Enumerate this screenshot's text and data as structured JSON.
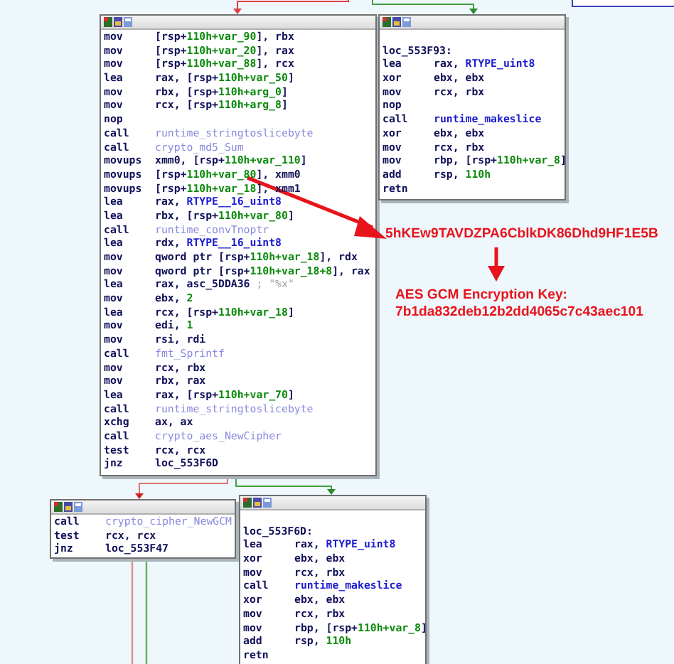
{
  "nodes": [
    {
      "lines": [
        {
          "kind": "instruction",
          "mnemonic": "mov",
          "operand": [
            {
              "text": "[rsp+",
              "kind": "text"
            },
            {
              "text": "110h+var_90",
              "kind": "offset"
            },
            {
              "text": "], rbx",
              "kind": "text"
            }
          ]
        },
        {
          "kind": "instruction",
          "mnemonic": "mov",
          "operand": [
            {
              "text": "[rsp+",
              "kind": "text"
            },
            {
              "text": "110h+var_20",
              "kind": "offset"
            },
            {
              "text": "], rax",
              "kind": "text"
            }
          ]
        },
        {
          "kind": "instruction",
          "mnemonic": "mov",
          "operand": [
            {
              "text": "[rsp+",
              "kind": "text"
            },
            {
              "text": "110h+var_88",
              "kind": "offset"
            },
            {
              "text": "], rcx",
              "kind": "text"
            }
          ]
        },
        {
          "kind": "instruction",
          "mnemonic": "lea",
          "operand": [
            {
              "text": "rax, [rsp+",
              "kind": "text"
            },
            {
              "text": "110h+var_50",
              "kind": "offset"
            },
            {
              "text": "]",
              "kind": "text"
            }
          ]
        },
        {
          "kind": "instruction",
          "mnemonic": "mov",
          "operand": [
            {
              "text": "rbx, [rsp+",
              "kind": "text"
            },
            {
              "text": "110h+arg_0",
              "kind": "offset"
            },
            {
              "text": "]",
              "kind": "text"
            }
          ]
        },
        {
          "kind": "instruction",
          "mnemonic": "mov",
          "operand": [
            {
              "text": "rcx, [rsp+",
              "kind": "text"
            },
            {
              "text": "110h+arg_8",
              "kind": "offset"
            },
            {
              "text": "]",
              "kind": "text"
            }
          ]
        },
        {
          "kind": "instruction",
          "mnemonic": "nop"
        },
        {
          "kind": "instruction",
          "mnemonic": "call",
          "operand": [
            {
              "text": "runtime_stringtoslicebyte",
              "kind": "function"
            }
          ]
        },
        {
          "kind": "instruction",
          "mnemonic": "call",
          "operand": [
            {
              "text": "crypto_md5_Sum",
              "kind": "function"
            }
          ]
        },
        {
          "kind": "instruction",
          "mnemonic": "movups",
          "operand": [
            {
              "text": "xmm0, [rsp+",
              "kind": "text"
            },
            {
              "text": "110h+var_110",
              "kind": "offset"
            },
            {
              "text": "]",
              "kind": "text"
            }
          ]
        },
        {
          "kind": "instruction",
          "mnemonic": "movups",
          "operand": [
            {
              "text": "[rsp+",
              "kind": "text"
            },
            {
              "text": "110h+var_80",
              "kind": "offset"
            },
            {
              "text": "], xmm0",
              "kind": "text"
            }
          ]
        },
        {
          "kind": "instruction",
          "mnemonic": "movups",
          "operand": [
            {
              "text": "[rsp+",
              "kind": "text"
            },
            {
              "text": "110h+var_18",
              "kind": "offset"
            },
            {
              "text": "], xmm1",
              "kind": "text"
            }
          ]
        },
        {
          "kind": "instruction",
          "mnemonic": "lea",
          "operand": [
            {
              "text": "rax, ",
              "kind": "text"
            },
            {
              "text": "RTYPE__16_uint8",
              "kind": "name"
            }
          ]
        },
        {
          "kind": "instruction",
          "mnemonic": "lea",
          "operand": [
            {
              "text": "rbx, [rsp+",
              "kind": "text"
            },
            {
              "text": "110h+var_80",
              "kind": "offset"
            },
            {
              "text": "]",
              "kind": "text"
            }
          ]
        },
        {
          "kind": "instruction",
          "mnemonic": "call",
          "operand": [
            {
              "text": "runtime_convTnoptr",
              "kind": "function"
            }
          ]
        },
        {
          "kind": "instruction",
          "mnemonic": "lea",
          "operand": [
            {
              "text": "rdx, ",
              "kind": "text"
            },
            {
              "text": "RTYPE__16_uint8",
              "kind": "name"
            }
          ]
        },
        {
          "kind": "instruction",
          "mnemonic": "mov",
          "operand": [
            {
              "text": "qword ptr [rsp+",
              "kind": "text"
            },
            {
              "text": "110h+var_18",
              "kind": "offset"
            },
            {
              "text": "], rdx",
              "kind": "text"
            }
          ]
        },
        {
          "kind": "instruction",
          "mnemonic": "mov",
          "operand": [
            {
              "text": "qword ptr [rsp+",
              "kind": "text"
            },
            {
              "text": "110h+var_18+8",
              "kind": "offset"
            },
            {
              "text": "], rax",
              "kind": "text"
            }
          ]
        },
        {
          "kind": "instruction",
          "mnemonic": "lea",
          "operand": [
            {
              "text": "rax, asc_5DDA36 ",
              "kind": "text"
            },
            {
              "text": "; \"%x\"",
              "kind": "comment"
            }
          ]
        },
        {
          "kind": "instruction",
          "mnemonic": "mov",
          "operand": [
            {
              "text": "ebx, ",
              "kind": "text"
            },
            {
              "text": "2",
              "kind": "offset"
            }
          ]
        },
        {
          "kind": "instruction",
          "mnemonic": "lea",
          "operand": [
            {
              "text": "rcx, [rsp+",
              "kind": "text"
            },
            {
              "text": "110h+var_18",
              "kind": "offset"
            },
            {
              "text": "]",
              "kind": "text"
            }
          ]
        },
        {
          "kind": "instruction",
          "mnemonic": "mov",
          "operand": [
            {
              "text": "edi, ",
              "kind": "text"
            },
            {
              "text": "1",
              "kind": "offset"
            }
          ]
        },
        {
          "kind": "instruction",
          "mnemonic": "mov",
          "operand": [
            {
              "text": "rsi, rdi",
              "kind": "text"
            }
          ]
        },
        {
          "kind": "instruction",
          "mnemonic": "call",
          "operand": [
            {
              "text": "fmt_Sprintf",
              "kind": "function"
            }
          ]
        },
        {
          "kind": "instruction",
          "mnemonic": "mov",
          "operand": [
            {
              "text": "rcx, rbx",
              "kind": "text"
            }
          ]
        },
        {
          "kind": "instruction",
          "mnemonic": "mov",
          "operand": [
            {
              "text": "rbx, rax",
              "kind": "text"
            }
          ]
        },
        {
          "kind": "instruction",
          "mnemonic": "lea",
          "operand": [
            {
              "text": "rax, [rsp+",
              "kind": "text"
            },
            {
              "text": "110h+var_70",
              "kind": "offset"
            },
            {
              "text": "]",
              "kind": "text"
            }
          ]
        },
        {
          "kind": "instruction",
          "mnemonic": "call",
          "operand": [
            {
              "text": "runtime_stringtoslicebyte",
              "kind": "function"
            }
          ]
        },
        {
          "kind": "instruction",
          "mnemonic": "xchg",
          "operand": [
            {
              "text": "ax, ax",
              "kind": "text"
            }
          ]
        },
        {
          "kind": "instruction",
          "mnemonic": "call",
          "operand": [
            {
              "text": "crypto_aes_NewCipher",
              "kind": "function"
            }
          ]
        },
        {
          "kind": "instruction",
          "mnemonic": "test",
          "operand": [
            {
              "text": "rcx, rcx",
              "kind": "text"
            }
          ]
        },
        {
          "kind": "instruction",
          "mnemonic": "jnz",
          "operand": [
            {
              "text": "loc_553F6D",
              "kind": "text"
            }
          ]
        }
      ]
    },
    {
      "lines": [
        {
          "kind": "label",
          "text": "loc_553F93:"
        },
        {
          "kind": "instruction",
          "mnemonic": "lea",
          "operand": [
            {
              "text": "rax, ",
              "kind": "text"
            },
            {
              "text": "RTYPE_uint8",
              "kind": "name"
            }
          ]
        },
        {
          "kind": "instruction",
          "mnemonic": "xor",
          "operand": [
            {
              "text": "ebx, ebx",
              "kind": "text"
            }
          ]
        },
        {
          "kind": "instruction",
          "mnemonic": "mov",
          "operand": [
            {
              "text": "rcx, rbx",
              "kind": "text"
            }
          ]
        },
        {
          "kind": "instruction",
          "mnemonic": "nop"
        },
        {
          "kind": "instruction",
          "mnemonic": "call",
          "operand": [
            {
              "text": "runtime_makeslice",
              "kind": "name"
            }
          ]
        },
        {
          "kind": "instruction",
          "mnemonic": "xor",
          "operand": [
            {
              "text": "ebx, ebx",
              "kind": "text"
            }
          ]
        },
        {
          "kind": "instruction",
          "mnemonic": "mov",
          "operand": [
            {
              "text": "rcx, rbx",
              "kind": "text"
            }
          ]
        },
        {
          "kind": "instruction",
          "mnemonic": "mov",
          "operand": [
            {
              "text": "rbp, [rsp+",
              "kind": "text"
            },
            {
              "text": "110h+var_8",
              "kind": "offset"
            },
            {
              "text": "]",
              "kind": "text"
            }
          ]
        },
        {
          "kind": "instruction",
          "mnemonic": "add",
          "operand": [
            {
              "text": "rsp, ",
              "kind": "text"
            },
            {
              "text": "110h",
              "kind": "offset"
            }
          ]
        },
        {
          "kind": "instruction",
          "mnemonic": "retn"
        }
      ]
    },
    {
      "lines": [
        {
          "kind": "instruction",
          "mnemonic": "call",
          "operand": [
            {
              "text": "crypto_cipher_NewGCM",
              "kind": "function"
            }
          ]
        },
        {
          "kind": "instruction",
          "mnemonic": "test",
          "operand": [
            {
              "text": "rcx, rcx",
              "kind": "text"
            }
          ]
        },
        {
          "kind": "instruction",
          "mnemonic": "jnz",
          "operand": [
            {
              "text": "loc_553F47",
              "kind": "text"
            }
          ]
        }
      ]
    },
    {
      "lines": [
        {
          "kind": "label",
          "text": "loc_553F6D:"
        },
        {
          "kind": "instruction",
          "mnemonic": "lea",
          "operand": [
            {
              "text": "rax, ",
              "kind": "text"
            },
            {
              "text": "RTYPE_uint8",
              "kind": "name"
            }
          ]
        },
        {
          "kind": "instruction",
          "mnemonic": "xor",
          "operand": [
            {
              "text": "ebx, ebx",
              "kind": "text"
            }
          ]
        },
        {
          "kind": "instruction",
          "mnemonic": "mov",
          "operand": [
            {
              "text": "rcx, rbx",
              "kind": "text"
            }
          ]
        },
        {
          "kind": "instruction",
          "mnemonic": "call",
          "operand": [
            {
              "text": "runtime_makeslice",
              "kind": "name"
            }
          ]
        },
        {
          "kind": "instruction",
          "mnemonic": "xor",
          "operand": [
            {
              "text": "ebx, ebx",
              "kind": "text"
            }
          ]
        },
        {
          "kind": "instruction",
          "mnemonic": "mov",
          "operand": [
            {
              "text": "rcx, rbx",
              "kind": "text"
            }
          ]
        },
        {
          "kind": "instruction",
          "mnemonic": "mov",
          "operand": [
            {
              "text": "rbp, [rsp+",
              "kind": "text"
            },
            {
              "text": "110h+var_8",
              "kind": "offset"
            },
            {
              "text": "]",
              "kind": "text"
            }
          ]
        },
        {
          "kind": "instruction",
          "mnemonic": "add",
          "operand": [
            {
              "text": "rsp, ",
              "kind": "text"
            },
            {
              "text": "110h",
              "kind": "offset"
            }
          ]
        },
        {
          "kind": "instruction",
          "mnemonic": "retn"
        }
      ]
    }
  ],
  "annotations": {
    "md5_string": "5hKEw9TAVDZPA6CblkDK86Dhd9HF1E5B",
    "key_title": "AES GCM Encryption Key:",
    "key_value": "7b1da832deb12b2dd4065c7c43aec101"
  }
}
